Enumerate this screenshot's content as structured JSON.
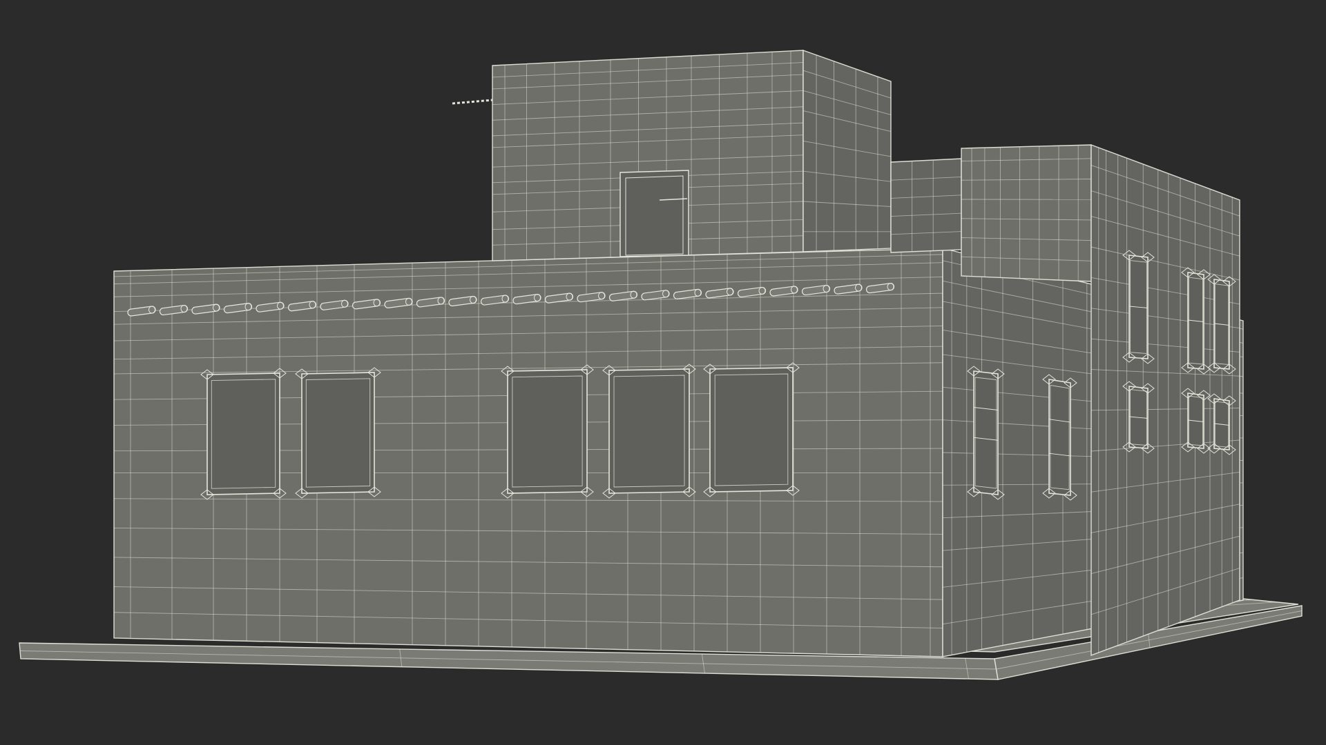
{
  "scene": {
    "subject": "wireframe-building",
    "colors": {
      "background": "#2b2b2b",
      "wall_front": "#6e6f69",
      "wall_side": "#646560",
      "wall_top": "#7a7b75",
      "window_recess": "#5f605b",
      "base_slab": "#7a7b74",
      "wire": "#e6e6dc"
    }
  }
}
